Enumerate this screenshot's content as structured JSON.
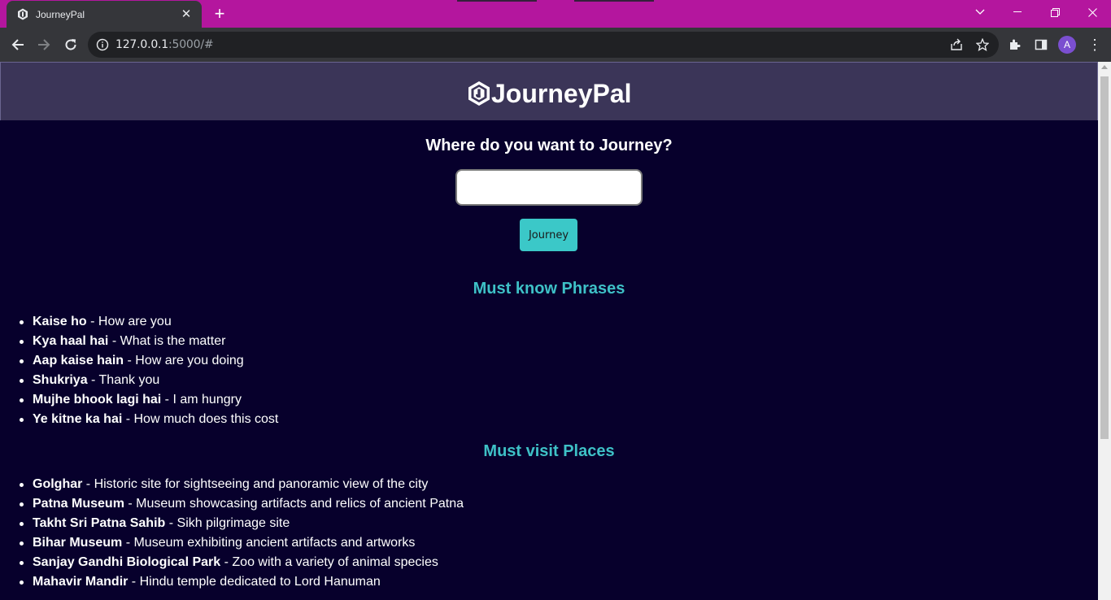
{
  "browser": {
    "tab_title": "JourneyPal",
    "url_host": "127.0.0.1",
    "url_rest": ":5000/#",
    "avatar_letter": "A"
  },
  "header": {
    "brand_name": "JourneyPal"
  },
  "search": {
    "question": "Where do you want to Journey?",
    "input_value": "",
    "button_label": "Journey"
  },
  "phrases": {
    "title": "Must know Phrases",
    "items": [
      {
        "term": "Kaise ho",
        "meaning": " - How are you"
      },
      {
        "term": "Kya haal hai",
        "meaning": " - What is the matter"
      },
      {
        "term": "Aap kaise hain",
        "meaning": " - How are you doing"
      },
      {
        "term": "Shukriya",
        "meaning": " - Thank you"
      },
      {
        "term": "Mujhe bhook lagi hai",
        "meaning": " - I am hungry"
      },
      {
        "term": "Ye kitne ka hai",
        "meaning": " - How much does this cost"
      }
    ]
  },
  "places": {
    "title": "Must visit Places",
    "items": [
      {
        "term": "Golghar",
        "meaning": " - Historic site for sightseeing and panoramic view of the city"
      },
      {
        "term": "Patna Museum",
        "meaning": " - Museum showcasing artifacts and relics of ancient Patna"
      },
      {
        "term": "Takht Sri Patna Sahib",
        "meaning": " - Sikh pilgrimage site"
      },
      {
        "term": "Bihar Museum",
        "meaning": " - Museum exhibiting ancient artifacts and artworks"
      },
      {
        "term": "Sanjay Gandhi Biological Park",
        "meaning": " - Zoo with a variety of animal species"
      },
      {
        "term": "Mahavir Mandir",
        "meaning": " - Hindu temple dedicated to Lord Hanuman"
      }
    ]
  },
  "colors": {
    "page_background": "#07002c",
    "header_background": "#3b3558",
    "section_title": "#3ec1c7",
    "button": "#3bc8c8",
    "tabbar": "#b4169e"
  }
}
